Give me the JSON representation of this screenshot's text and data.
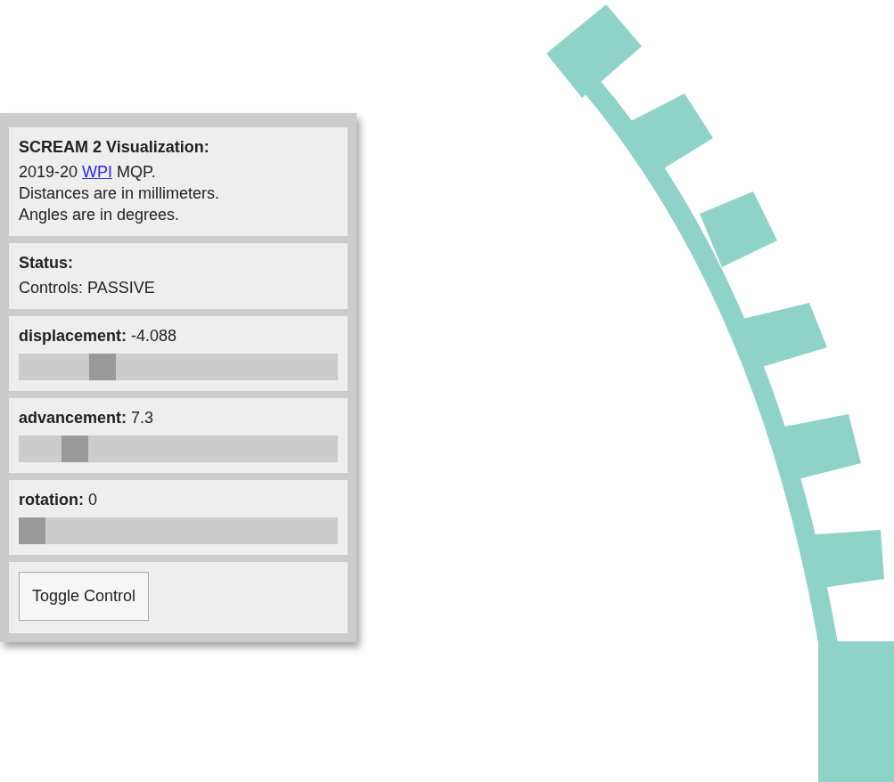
{
  "info": {
    "title": "SCREAM 2 Visualization:",
    "before_link": "2019-20 ",
    "link": "WPI",
    "after_link": " MQP.",
    "lines": [
      "Distances are in millimeters.",
      "Angles are in degrees."
    ]
  },
  "status": {
    "title": "Status:",
    "text": "Controls: PASSIVE"
  },
  "sliders": [
    {
      "label": "displacement:",
      "reading": "-4.088",
      "level": 0.24
    },
    {
      "label": "advancement:",
      "reading": "7.3",
      "level": 0.145
    },
    {
      "label": "rotation:",
      "reading": "0",
      "level": 0
    }
  ],
  "buttons": [
    "Toggle Control"
  ]
}
